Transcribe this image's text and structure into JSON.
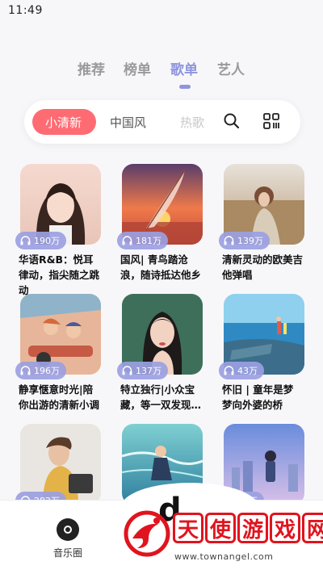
{
  "status_bar": {
    "time": "11:49"
  },
  "main_tabs": [
    {
      "label": "推荐",
      "active": false
    },
    {
      "label": "榜单",
      "active": false
    },
    {
      "label": "歌单",
      "active": true
    },
    {
      "label": "艺人",
      "active": false
    }
  ],
  "sub_tabs": [
    {
      "label": "小清新",
      "active": true
    },
    {
      "label": "中国风",
      "active": false
    },
    {
      "label": "热歌",
      "active": false
    }
  ],
  "sub_icons": {
    "search": "search-icon",
    "more": "grid-icon"
  },
  "playlists": [
    {
      "plays": "190万",
      "title": "华语R&B：悦耳律动，指尖随之跳动",
      "cover": "portrait-girl"
    },
    {
      "plays": "181万",
      "title": "国风| 青鸟踏沧浪，随诗抵达他乡",
      "cover": "feather-sunset"
    },
    {
      "plays": "139万",
      "title": "清新灵动的欧美吉他弹唱",
      "cover": "field-girl"
    },
    {
      "plays": "196万",
      "title": "静享惬意时光|陪你出游的清新小调",
      "cover": "car-illustration"
    },
    {
      "plays": "137万",
      "title": "特立独行|小众宝藏，等一双发现…",
      "cover": "braids-girl"
    },
    {
      "plays": "43万",
      "title": "怀旧 | 童年是梦 梦向外婆的桥",
      "cover": "seaside-illustration"
    },
    {
      "plays": "282万",
      "title": "",
      "cover": "boy-portrait"
    },
    {
      "plays": "",
      "title": "",
      "cover": "water-illustration"
    },
    {
      "plays": "27万",
      "title": "",
      "cover": "city-illustration"
    }
  ],
  "bottom_nav": {
    "item_label": "音乐圈",
    "partial_glyph": "d"
  },
  "watermark": {
    "chars": [
      "天",
      "使",
      "游",
      "戏",
      "网"
    ],
    "url": "www.townangel.com"
  },
  "colors": {
    "accent": "#8f95dc",
    "pill": "#ff6b72",
    "badge": "#9ba0e1",
    "watermark": "#e0141e"
  }
}
